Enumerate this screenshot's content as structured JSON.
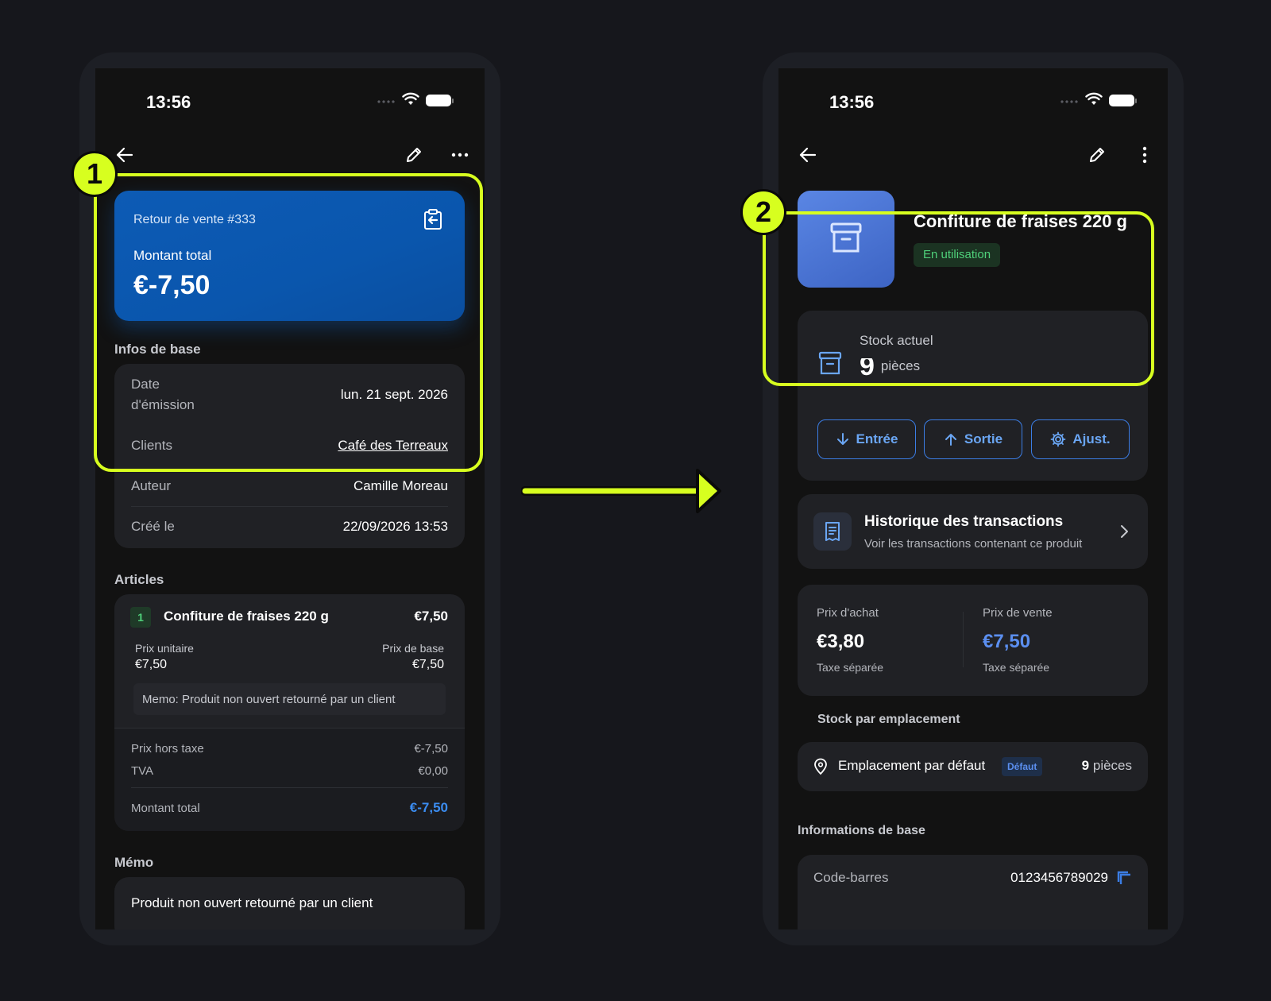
{
  "colors": {
    "background": "#16171c",
    "accent": "#d7ff1f",
    "brand_blue": "#0d5bb5",
    "link_blue": "#6aa6f4",
    "status_green": "#4fd07a"
  },
  "left": {
    "status_time": "13:56",
    "hero": {
      "title": "Retour de vente #333",
      "total_label": "Montant total",
      "total_amount": "€-7,50",
      "icon": "clipboard-return-icon"
    },
    "basic_info": {
      "title": "Infos de base",
      "issue_date_label_1": "Date",
      "issue_date_label_2": "d'émission",
      "issue_date_value": "lun. 21 sept. 2026",
      "clients_label": "Clients",
      "clients_value": "Café des Terreaux",
      "author_label": "Auteur",
      "author_value": "Camille Moreau",
      "created_label": "Créé le",
      "created_value": "22/09/2026 13:53"
    },
    "articles": {
      "title": "Articles",
      "item_index": "1",
      "item_name": "Confiture de fraises 220 g",
      "item_amount": "€7,50",
      "unit_price_label": "Prix unitaire",
      "unit_price_value": "€7,50",
      "base_price_label": "Prix de base",
      "base_price_value": "€7,50",
      "memo": "Memo: Produit non ouvert retourné par un client",
      "net_label": "Prix hors taxe",
      "net_value": "€-7,50",
      "vat_label": "TVA",
      "vat_value": "€0,00",
      "total_label": "Montant total",
      "total_value": "€-7,50"
    },
    "memo": {
      "title": "Mémo",
      "text": "Produit non ouvert retourné par un client"
    }
  },
  "right": {
    "status_time": "13:56",
    "product": {
      "name": "Confiture de fraises 220 g",
      "status": "En utilisation",
      "icon": "archive-box-icon"
    },
    "stock": {
      "label": "Stock actuel",
      "value": "9",
      "unit": "pièces",
      "in_label": "Entrée",
      "out_label": "Sortie",
      "adjust_label": "Ajust."
    },
    "history": {
      "title": "Historique des transactions",
      "subtitle": "Voir les transactions contenant ce produit"
    },
    "prices": {
      "purchase_label": "Prix d'achat",
      "purchase_value": "€3,80",
      "purchase_tax": "Taxe séparée",
      "sale_label": "Prix de vente",
      "sale_value": "€7,50",
      "sale_tax": "Taxe séparée"
    },
    "locations": {
      "title": "Stock par emplacement",
      "name": "Emplacement par défaut",
      "badge": "Défaut",
      "qty": "9",
      "unit": "pièces"
    },
    "base_info": {
      "title": "Informations de base",
      "barcode_label": "Code-barres",
      "barcode_value": "0123456789029"
    }
  },
  "annotations": {
    "step_1": "1",
    "step_2": "2"
  }
}
